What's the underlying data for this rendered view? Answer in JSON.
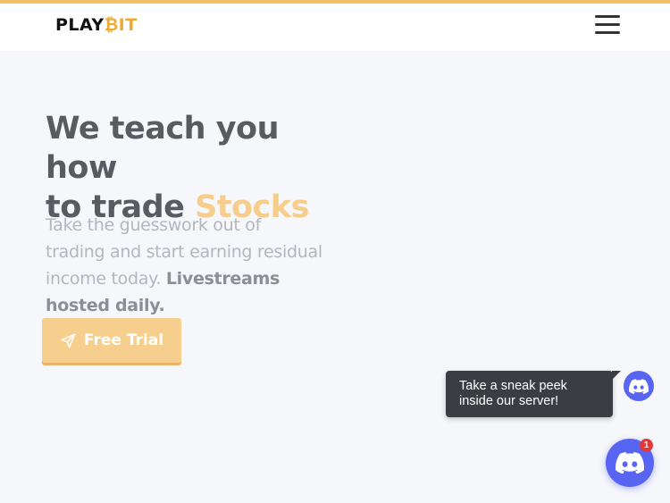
{
  "brand": {
    "logo_prefix": "PLAY",
    "logo_suffix": "IT",
    "logo_mark": "bitcoin-b-icon",
    "accent_color": "#f3bf68"
  },
  "navbar": {
    "menu_icon": "hamburger-menu-icon"
  },
  "hero": {
    "title_line1": "We teach you how",
    "title_line2_prefix": "to trade",
    "title_highlight": "Stocks",
    "subtitle": "Take the guesswork out of trading and start earning residual income today.",
    "subtitle_bold": "Livestreams hosted daily."
  },
  "cta": {
    "label": "Free Trial",
    "icon": "send-arrow-icon",
    "color": "#f6cf8f"
  },
  "discord_widget": {
    "tooltip_text": "Take a sneak peek inside our server!",
    "small_icon": "discord-icon",
    "launcher_icon": "discord-icon",
    "badge_count": "1",
    "color": "#5865f2"
  }
}
